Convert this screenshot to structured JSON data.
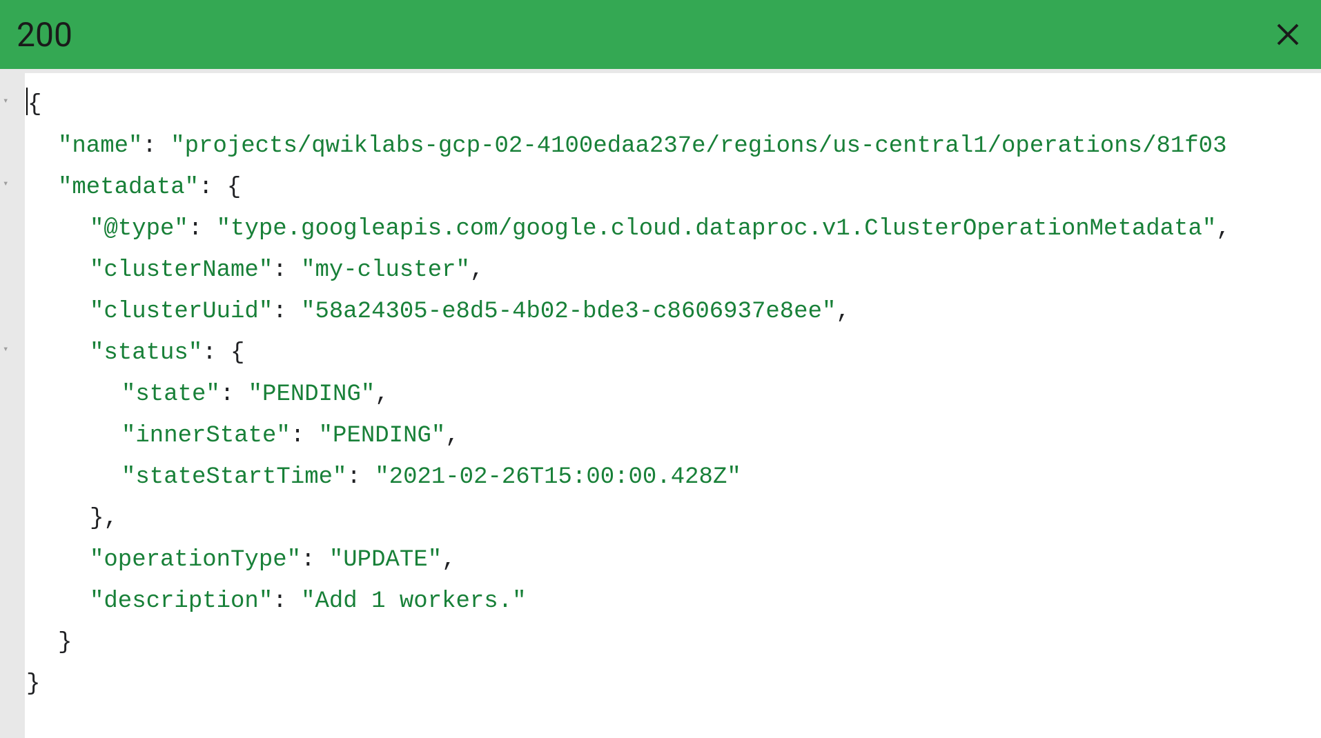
{
  "header": {
    "status_code": "200"
  },
  "response": {
    "open_brace": "{",
    "name_key": "\"name\"",
    "name_value": "\"projects/qwiklabs-gcp-02-4100edaa237e/regions/us-central1/operations/81f03",
    "metadata_key": "\"metadata\"",
    "metadata_open": "{",
    "type_key": "\"@type\"",
    "type_value": "\"type.googleapis.com/google.cloud.dataproc.v1.ClusterOperationMetadata\"",
    "clusterName_key": "\"clusterName\"",
    "clusterName_value": "\"my-cluster\"",
    "clusterUuid_key": "\"clusterUuid\"",
    "clusterUuid_value": "\"58a24305-e8d5-4b02-bde3-c8606937e8ee\"",
    "status_key": "\"status\"",
    "status_open": "{",
    "state_key": "\"state\"",
    "state_value": "\"PENDING\"",
    "innerState_key": "\"innerState\"",
    "innerState_value": "\"PENDING\"",
    "stateStartTime_key": "\"stateStartTime\"",
    "stateStartTime_value": "\"2021-02-26T15:00:00.428Z\"",
    "status_close": "}",
    "operationType_key": "\"operationType\"",
    "operationType_value": "\"UPDATE\"",
    "description_key": "\"description\"",
    "description_value": "\"Add 1 workers.\"",
    "metadata_close": "}",
    "close_brace": "}",
    "colon": ": ",
    "comma": ",",
    "comma_space": ","
  }
}
